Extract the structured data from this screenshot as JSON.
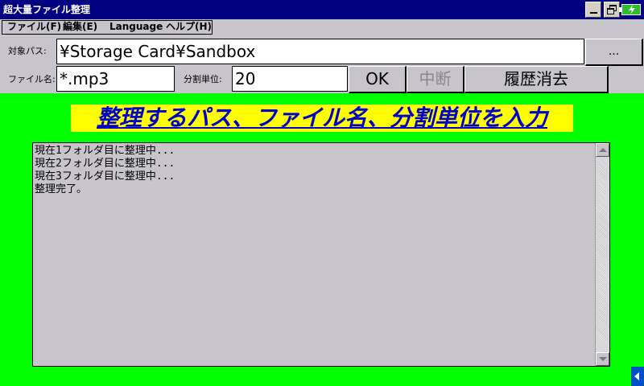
{
  "window": {
    "title": "超大量ファイル整理"
  },
  "menu": {
    "items": [
      "ファイル(F)",
      "編集(E)",
      "Language",
      "ヘルプ(H)"
    ]
  },
  "form": {
    "path_label": "対象パス:",
    "path_value": "¥Storage Card¥Sandbox",
    "browse_label": "...",
    "filename_label": "ファイル名:",
    "filename_value": "*.mp3",
    "split_label": "分割単位:",
    "split_value": "20",
    "ok_label": "OK",
    "abort_label": "中断",
    "clear_history_label": "履歴消去"
  },
  "instruction": "整理するパス、ファイル名、分割単位を入力",
  "log": {
    "lines": [
      "現在1フォルダ目に整理中...",
      "現在2フォルダ目に整理中...",
      "現在3フォルダ目に整理中...",
      "整理完了。"
    ]
  },
  "icons": {
    "battery": "battery-charging-icon",
    "sip": "input-panel-arrow-icon"
  },
  "colors": {
    "background": "#00ff00",
    "titlebar": "#000080",
    "heading_bg": "#ffff00",
    "heading_text": "#0000cc"
  }
}
